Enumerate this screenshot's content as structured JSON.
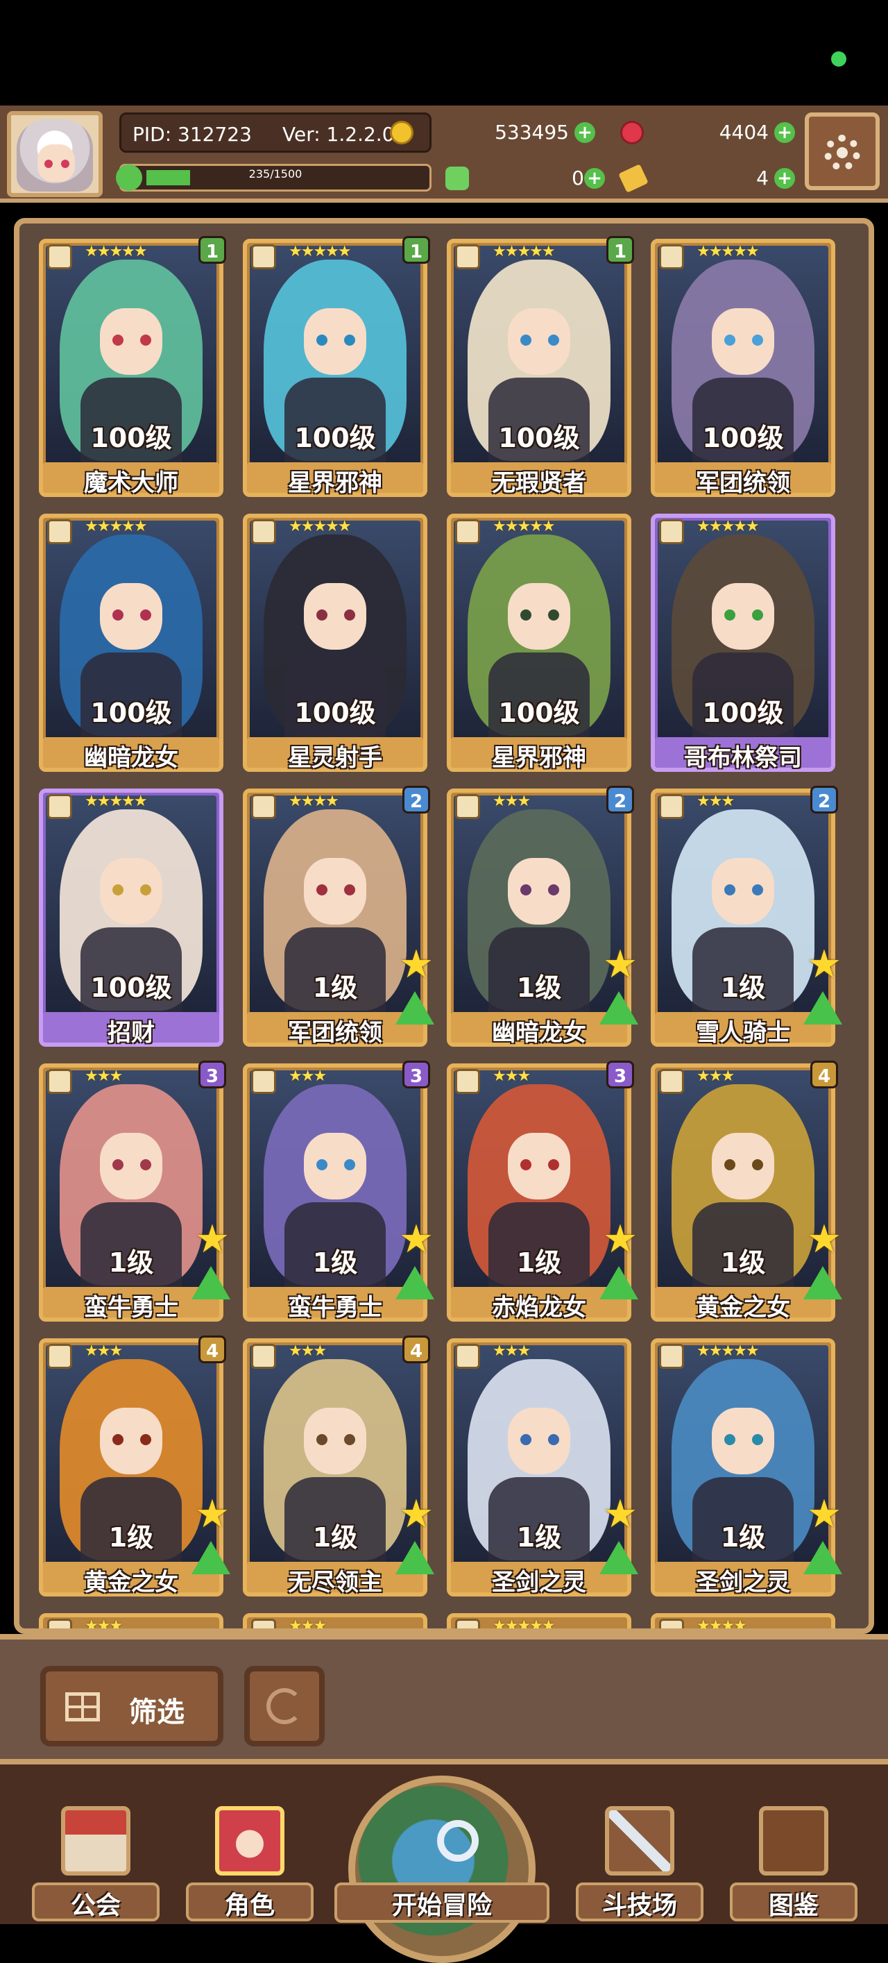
{
  "header": {
    "pid": "PID: 312723",
    "version": "Ver: 1.2.2.0",
    "gold": "533495",
    "gems": "4404",
    "stamina": "235/1500",
    "stamina_fraction": 0.157,
    "clover": "0",
    "scroll": "4"
  },
  "cards": [
    {
      "name": "魔术大师",
      "level": "100级",
      "stars": "★★★★★",
      "badge": "1",
      "badge_color": "#5aa84a",
      "frame": "gold",
      "hair": "#5fbf9c",
      "eyes": "#c03a4a"
    },
    {
      "name": "星界邪神",
      "level": "100级",
      "stars": "★★★★★",
      "badge": "1",
      "badge_color": "#5aa84a",
      "frame": "gold",
      "hair": "#55c0d8",
      "eyes": "#2a8ac0"
    },
    {
      "name": "无瑕贤者",
      "level": "100级",
      "stars": "★★★★★",
      "badge": "1",
      "badge_color": "#5aa84a",
      "frame": "gold",
      "hair": "#efe2c8",
      "eyes": "#3a8ac8"
    },
    {
      "name": "军团统领",
      "level": "100级",
      "stars": "★★★★★",
      "badge": "",
      "badge_color": "",
      "frame": "gold",
      "hair": "#8a7aa8",
      "eyes": "#4aa0d8"
    },
    {
      "name": "幽暗龙女",
      "level": "100级",
      "stars": "★★★★★",
      "badge": "",
      "badge_color": "",
      "frame": "gold",
      "hair": "#2a6aa8",
      "eyes": "#b03050"
    },
    {
      "name": "星灵射手",
      "level": "100级",
      "stars": "★★★★★",
      "badge": "",
      "badge_color": "",
      "frame": "gold",
      "hair": "#2a2a34",
      "eyes": "#8a3040"
    },
    {
      "name": "星界邪神",
      "level": "100级",
      "stars": "★★★★★",
      "badge": "",
      "badge_color": "",
      "frame": "gold",
      "hair": "#7aa04a",
      "eyes": "#304a30"
    },
    {
      "name": "哥布林祭司",
      "level": "100级",
      "stars": "★★★★★",
      "badge": "",
      "badge_color": "",
      "frame": "purple",
      "hair": "#5a4a3a",
      "eyes": "#3aa040"
    },
    {
      "name": "招财",
      "level": "100级",
      "stars": "★★★★★",
      "badge": "",
      "badge_color": "",
      "frame": "purple",
      "hair": "#f2e4d8",
      "eyes": "#c8a03a"
    },
    {
      "name": "军团统领",
      "level": "1级",
      "stars": "★★★★",
      "badge": "2",
      "badge_color": "#4a8ad0",
      "frame": "gold",
      "hair": "#d8b08a",
      "eyes": "#a03040"
    },
    {
      "name": "幽暗龙女",
      "level": "1级",
      "stars": "★★★",
      "badge": "2",
      "badge_color": "#4a8ad0",
      "frame": "gold",
      "hair": "#5a6a5a",
      "eyes": "#6a3a6a"
    },
    {
      "name": "雪人骑士",
      "level": "1级",
      "stars": "★★★",
      "badge": "2",
      "badge_color": "#4a8ad0",
      "frame": "gold",
      "hair": "#cfe4f2",
      "eyes": "#3a7ab8"
    },
    {
      "name": "蛮牛勇士",
      "level": "1级",
      "stars": "★★★",
      "badge": "3",
      "badge_color": "#8a5ac8",
      "frame": "gold",
      "hair": "#e0908a",
      "eyes": "#a03a4a"
    },
    {
      "name": "蛮牛勇士",
      "level": "1级",
      "stars": "★★★",
      "badge": "3",
      "badge_color": "#8a5ac8",
      "frame": "gold",
      "hair": "#7a6ab8",
      "eyes": "#3a8ac8"
    },
    {
      "name": "赤焰龙女",
      "level": "1级",
      "stars": "★★★",
      "badge": "3",
      "badge_color": "#8a5ac8",
      "frame": "gold",
      "hair": "#d0583a",
      "eyes": "#b03030"
    },
    {
      "name": "黄金之女",
      "level": "1级",
      "stars": "★★★",
      "badge": "4",
      "badge_color": "#c8983a",
      "frame": "gold",
      "hair": "#c8a03a",
      "eyes": "#6a4a1a"
    },
    {
      "name": "黄金之女",
      "level": "1级",
      "stars": "★★★",
      "badge": "4",
      "badge_color": "#c8983a",
      "frame": "gold",
      "hair": "#e08a2a",
      "eyes": "#8a2a1a"
    },
    {
      "name": "无尽领主",
      "level": "1级",
      "stars": "★★★",
      "badge": "4",
      "badge_color": "#c8983a",
      "frame": "gold",
      "hair": "#d8c08a",
      "eyes": "#6a4a2a"
    },
    {
      "name": "圣剑之灵",
      "level": "1级",
      "stars": "★★★",
      "badge": "",
      "badge_color": "",
      "frame": "gold",
      "hair": "#d8e0ee",
      "eyes": "#3a6ab0"
    },
    {
      "name": "圣剑之灵",
      "level": "1级",
      "stars": "★★★★★",
      "badge": "",
      "badge_color": "",
      "frame": "gold",
      "hair": "#4a8ac0",
      "eyes": "#2a8aa8"
    }
  ],
  "partial_row_stars": [
    "★★★",
    "★★★",
    "★★★★★",
    "★★★★"
  ],
  "toolbar": {
    "filter_label": "筛选"
  },
  "nav": {
    "guild": "公会",
    "characters": "角色",
    "adventure": "开始冒险",
    "arena": "斗技场",
    "codex": "图鉴"
  }
}
